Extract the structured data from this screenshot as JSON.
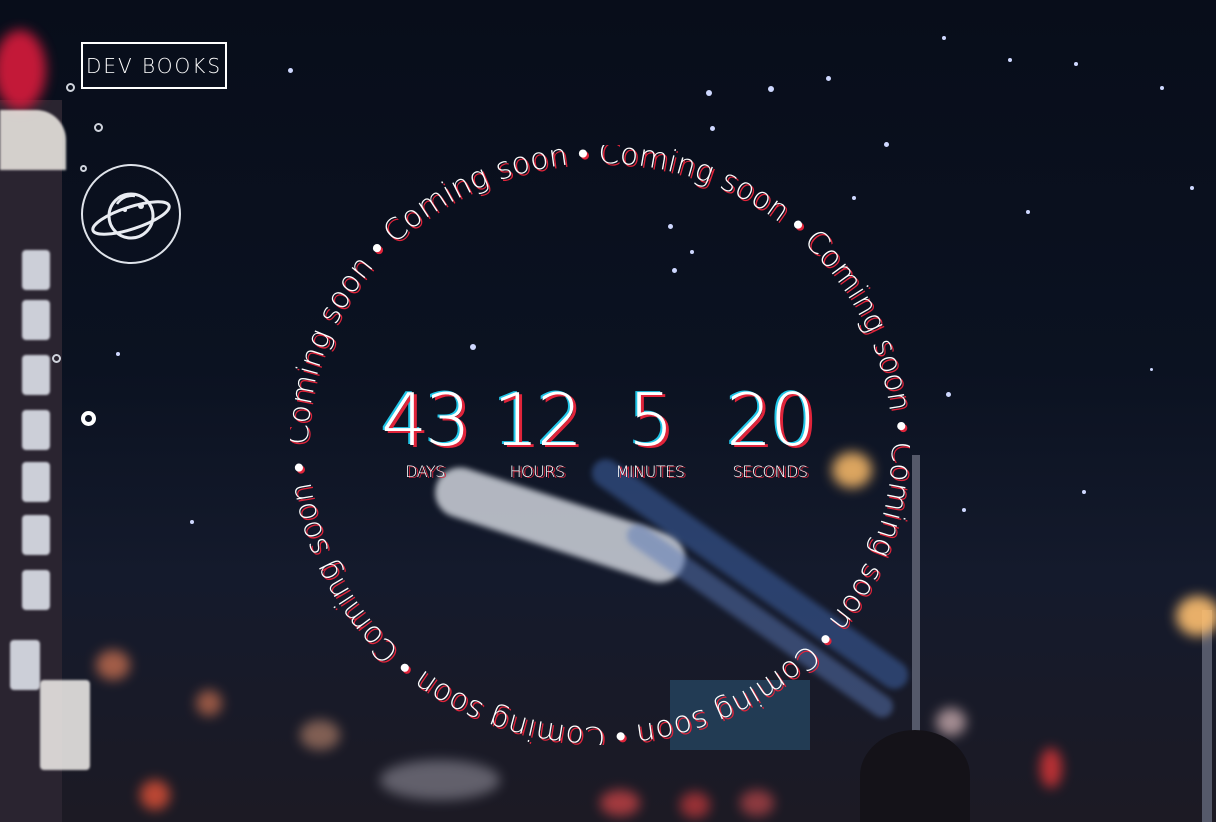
{
  "brand": {
    "label": "DEV BOOKS"
  },
  "nav": {
    "active_index": 4,
    "dot_count": 5
  },
  "ring": {
    "text": "Coming soon",
    "repeats": 11,
    "separator": "•"
  },
  "countdown": {
    "days": {
      "value": "43",
      "label": "DAYS"
    },
    "hours": {
      "value": "12",
      "label": "HOURS"
    },
    "minutes": {
      "value": "5",
      "label": "MINUTES"
    },
    "seconds": {
      "value": "20",
      "label": "SECONDS"
    }
  },
  "icons": {
    "logo": "planet-icon"
  },
  "colors": {
    "accent_red": "#e0243a",
    "accent_cyan": "#21c6e8",
    "text": "#ffffff"
  }
}
